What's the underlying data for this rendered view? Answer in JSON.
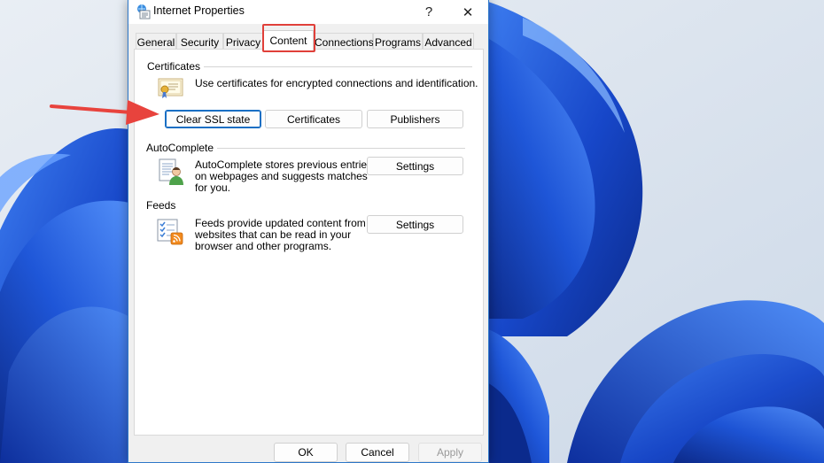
{
  "window": {
    "title": "Internet Properties",
    "help_glyph": "?",
    "close_glyph": "✕"
  },
  "tabs": [
    {
      "label": "General"
    },
    {
      "label": "Security"
    },
    {
      "label": "Privacy"
    },
    {
      "label": "Content",
      "selected": true
    },
    {
      "label": "Connections"
    },
    {
      "label": "Programs"
    },
    {
      "label": "Advanced"
    }
  ],
  "certificates": {
    "heading": "Certificates",
    "description": "Use certificates for encrypted connections and identification.",
    "clear_ssl_label": "Clear SSL state",
    "certificates_label": "Certificates",
    "publishers_label": "Publishers"
  },
  "autocomplete": {
    "heading": "AutoComplete",
    "description_lines": [
      "AutoComplete stores previous entries",
      "on webpages and suggests matches",
      "for you."
    ],
    "settings_label": "Settings"
  },
  "feeds": {
    "heading": "Feeds",
    "description_lines": [
      "Feeds provide updated content from",
      "websites that can be read in your",
      "browser and other programs."
    ],
    "settings_label": "Settings"
  },
  "footer": {
    "ok_label": "OK",
    "cancel_label": "Cancel",
    "apply_label": "Apply",
    "apply_enabled": false
  },
  "annotation": {
    "arrow_color": "#e8433d",
    "highlight_color": "#e0403a",
    "highlighted_tab": "Content",
    "arrow_target": "Clear SSL state"
  },
  "colors": {
    "accent": "#1a6fc4",
    "wallpaper_blue": "#1f5fd6"
  }
}
